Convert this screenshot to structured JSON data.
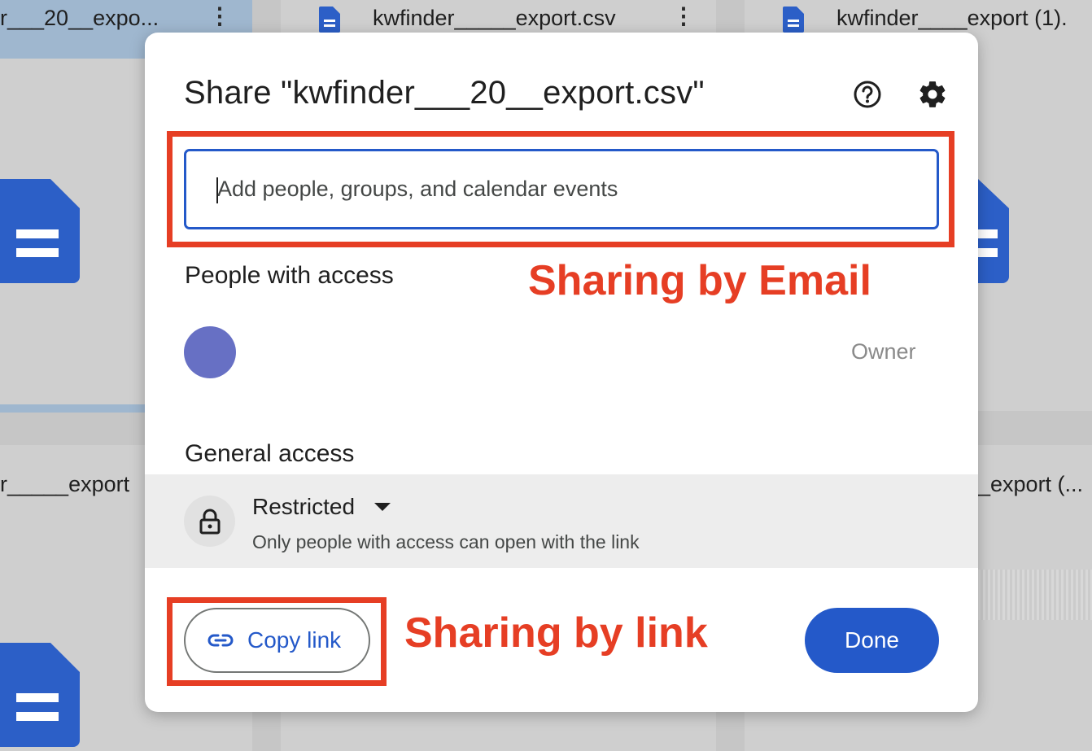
{
  "background": {
    "top_files": [
      {
        "title": "r___20__expo..."
      },
      {
        "title": "kwfinder_____export.csv"
      },
      {
        "title": "kwfinder____export (1)."
      }
    ],
    "bottom_files": [
      {
        "title": "r_____export"
      },
      {
        "title": "_export (..."
      }
    ]
  },
  "dialog": {
    "title": "Share \"kwfinder___20__export.csv\"",
    "help_icon": "help-circle-icon",
    "settings_icon": "gear-icon",
    "share_input": {
      "value": "",
      "placeholder": "Add people, groups, and calendar events"
    },
    "people_label": "People with access",
    "owner": {
      "role": "Owner",
      "avatar_color": "#6770c4"
    },
    "general_access_label": "General access",
    "access": {
      "level": "Restricted",
      "description": "Only people with access can open with the link",
      "icon": "lock-icon"
    },
    "copy_link_label": "Copy link",
    "done_label": "Done"
  },
  "annotations": {
    "email_note": "Sharing by Email",
    "link_note": "Sharing by link",
    "color": "#e63e24"
  },
  "colors": {
    "accent": "#2459c9",
    "dim_background": "#c6c6c6"
  }
}
